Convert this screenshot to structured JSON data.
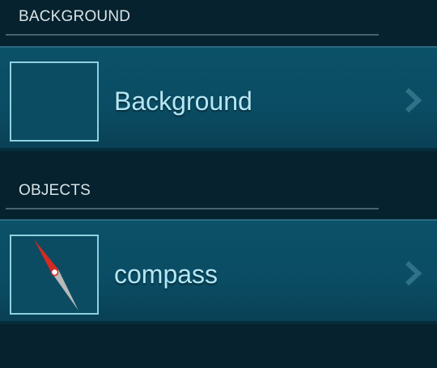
{
  "sections": [
    {
      "title": "BACKGROUND",
      "item": {
        "label": "Background",
        "thumbnail_icon": "empty-frame",
        "arrow_icon": "chevron-right-icon"
      }
    },
    {
      "title": "OBJECTS",
      "item": {
        "label": "compass",
        "thumbnail_icon": "compass-needle-icon",
        "arrow_icon": "chevron-right-icon"
      }
    }
  ],
  "colors": {
    "background": "#05222e",
    "row": "#0a4c63",
    "label_text": "#b4e6f4",
    "header_text": "#d8e4e8",
    "thumb_border": "#8fd1e2",
    "needle_north": "#d42a22",
    "needle_south": "#b9b9b9"
  }
}
